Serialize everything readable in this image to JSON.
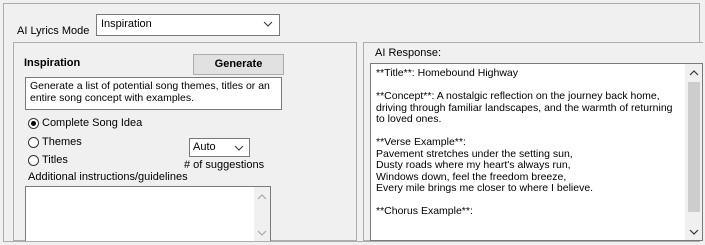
{
  "mode": {
    "label": "AI Lyrics Mode",
    "selected": "Inspiration"
  },
  "inspiration": {
    "title": "Inspiration",
    "generate_label": "Generate",
    "description": "Generate a list of potential song themes, titles or an entire song concept with examples.",
    "options": [
      {
        "label": "Complete Song Idea",
        "checked": true
      },
      {
        "label": "Themes",
        "checked": false
      },
      {
        "label": "Titles",
        "checked": false
      }
    ],
    "suggestions_value": "Auto",
    "suggestions_label": "# of suggestions",
    "additional_label": "Additional instructions/guidelines",
    "additional_value": ""
  },
  "response": {
    "label": "AI Response:",
    "text": "**Title**: Homebound Highway\n\n**Concept**: A nostalgic reflection on the journey back home, driving through familiar landscapes, and the warmth of returning to loved ones.\n\n**Verse Example**:\nPavement stretches under the setting sun,\nDusty roads where my heart's always run,\nWindows down, feel the freedom breeze,\nEvery mile brings me closer to where I believe.\n\n**Chorus Example**:"
  }
}
